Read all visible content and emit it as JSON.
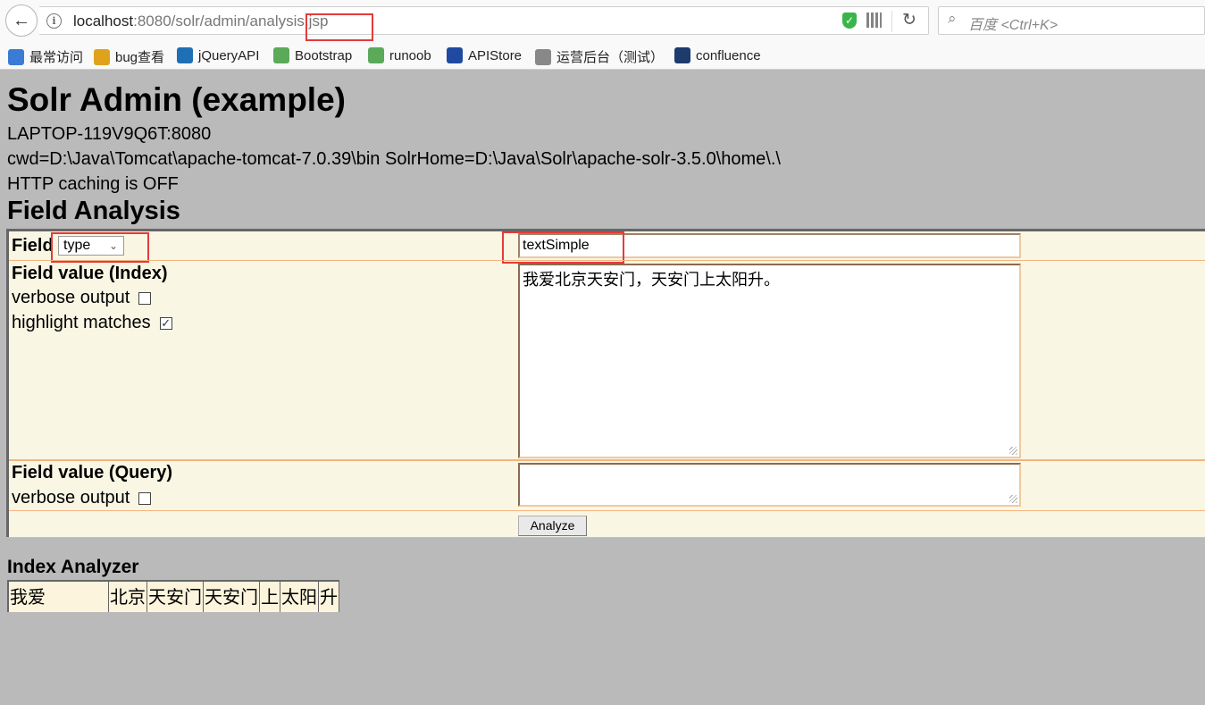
{
  "browser": {
    "url_host": "localhost",
    "url_rest": ":8080/solr/admin/",
    "url_highlight": "analysis",
    "url_tail": ".jsp",
    "search_placeholder": "百度 <Ctrl+K>",
    "bookmarks": [
      {
        "label": "最常访问",
        "icon": "most-visited-icon",
        "color": "#3a7bd5"
      },
      {
        "label": "bug查看",
        "icon": "bug-tracker-icon",
        "color": "#e0a21a"
      },
      {
        "label": "jQueryAPI",
        "icon": "jquery-icon",
        "color": "#1f6fb5"
      },
      {
        "label": "Bootstrap",
        "icon": "bootstrap-icon",
        "color": "#5aaa5a"
      },
      {
        "label": "runoob",
        "icon": "runoob-icon",
        "color": "#5aaa5a"
      },
      {
        "label": "APIStore",
        "icon": "apistore-icon",
        "color": "#1f4aa0"
      },
      {
        "label": "运营后台（测试）",
        "icon": "globe-icon",
        "color": "#888888"
      },
      {
        "label": "confluence",
        "icon": "confluence-icon",
        "color": "#1e3b6e"
      }
    ]
  },
  "page": {
    "title": "Solr Admin (example)",
    "host": "LAPTOP-119V9Q6T:8080",
    "cwd": "cwd=D:\\Java\\Tomcat\\apache-tomcat-7.0.39\\bin SolrHome=D:\\Java\\Solr\\apache-solr-3.5.0\\home\\.\\",
    "caching": "HTTP caching is OFF",
    "section_title": "Field Analysis"
  },
  "form": {
    "field_label": "Field",
    "field_select_value": "type",
    "field_name_value": "textSimple",
    "index_label": "Field value (Index)",
    "index_verbose_label": "verbose output",
    "index_verbose_checked": false,
    "highlight_label": "highlight matches",
    "highlight_checked": true,
    "index_value": "我爱北京天安门，天安门上太阳升。",
    "query_label": "Field value (Query)",
    "query_verbose_label": "verbose output",
    "query_verbose_checked": false,
    "query_value": "",
    "analyze_label": "Analyze"
  },
  "results": {
    "index_analyzer_title": "Index Analyzer",
    "tokens": [
      "我爱",
      "北京",
      "天安门",
      "天安门",
      "上",
      "太阳",
      "升"
    ]
  },
  "colors": {
    "highlight_box": "#e43b3b",
    "form_bg": "#f9f6e4",
    "page_bg": "#bababa"
  }
}
